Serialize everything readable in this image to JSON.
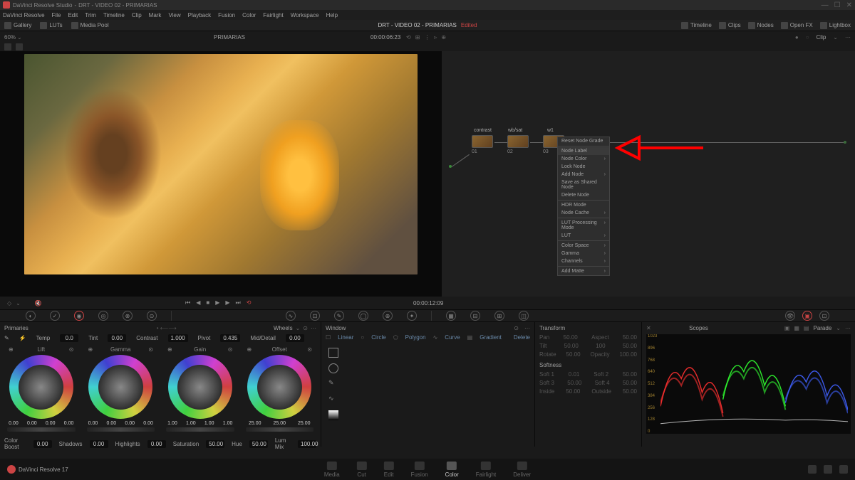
{
  "titlebar": {
    "app": "DaVinci Resolve Studio",
    "project": "DRT - VIDEO 02 - PRIMARIAS"
  },
  "menubar": [
    "DaVinci Resolve",
    "File",
    "Edit",
    "Trim",
    "Timeline",
    "Clip",
    "Mark",
    "View",
    "Playback",
    "Fusion",
    "Color",
    "Fairlight",
    "Workspace",
    "Help"
  ],
  "topbar": {
    "left": [
      "Gallery",
      "LUTs",
      "Media Pool"
    ],
    "title": "DRT - VIDEO 02 - PRIMARIAS",
    "edited": "Edited",
    "right": [
      "Timeline",
      "Clips",
      "Nodes",
      "Open FX",
      "Lightbox"
    ]
  },
  "secondbar": {
    "zoom": "60%",
    "clipname": "PRIMARIAS",
    "timecode": "00:00:06:23",
    "clip": "Clip"
  },
  "transport": {
    "timecode": "00:00:12:09"
  },
  "nodes": [
    {
      "label": "contrast",
      "num": "01"
    },
    {
      "label": "wb/sat",
      "num": "02"
    },
    {
      "label": "w1",
      "num": "03"
    }
  ],
  "context_menu": [
    {
      "label": "Reset Node Grade",
      "arrow": false
    },
    {
      "sep": true
    },
    {
      "label": "Node Label",
      "arrow": false,
      "highlighted": true
    },
    {
      "label": "Node Color",
      "arrow": true
    },
    {
      "label": "Lock Node",
      "arrow": false
    },
    {
      "label": "Add Node",
      "arrow": true
    },
    {
      "label": "Save as Shared Node",
      "arrow": false
    },
    {
      "label": "Delete Node",
      "arrow": false
    },
    {
      "sep": true
    },
    {
      "label": "HDR Mode",
      "arrow": false
    },
    {
      "label": "Node Cache",
      "arrow": true
    },
    {
      "sep": true
    },
    {
      "label": "LUT Processing Mode",
      "arrow": true
    },
    {
      "label": "LUT",
      "arrow": true
    },
    {
      "sep": true
    },
    {
      "label": "Color Space",
      "arrow": true
    },
    {
      "label": "Gamma",
      "arrow": true
    },
    {
      "label": "Channels",
      "arrow": true
    },
    {
      "sep": true
    },
    {
      "label": "Add Matte",
      "arrow": true
    }
  ],
  "primaries": {
    "title": "Primaries",
    "mode": "Wheels",
    "temp": {
      "label": "Temp",
      "val": "0.0"
    },
    "tint": {
      "label": "Tint",
      "val": "0.00"
    },
    "contrast": {
      "label": "Contrast",
      "val": "1.000"
    },
    "pivot": {
      "label": "Pivot",
      "val": "0.435"
    },
    "middetail": {
      "label": "Mid/Detail",
      "val": "0.00"
    },
    "wheels": [
      {
        "name": "Lift",
        "vals": [
          "0.00",
          "0.00",
          "0.00",
          "0.00"
        ]
      },
      {
        "name": "Gamma",
        "vals": [
          "0.00",
          "0.00",
          "0.00",
          "0.00"
        ]
      },
      {
        "name": "Gain",
        "vals": [
          "1.00",
          "1.00",
          "1.00",
          "1.00"
        ]
      },
      {
        "name": "Offset",
        "vals": [
          "25.00",
          "25.00",
          "25.00"
        ]
      }
    ],
    "bottom": {
      "colorboost": {
        "label": "Color Boost",
        "val": "0.00"
      },
      "shadows": {
        "label": "Shadows",
        "val": "0.00"
      },
      "highlights": {
        "label": "Highlights",
        "val": "0.00"
      },
      "saturation": {
        "label": "Saturation",
        "val": "50.00"
      },
      "hue": {
        "label": "Hue",
        "val": "50.00"
      },
      "lummix": {
        "label": "Lum Mix",
        "val": "100.00"
      }
    }
  },
  "qualifier": {
    "title": "Window",
    "delete": "Delete",
    "tabs": [
      "Linear",
      "Circle",
      "Polygon",
      "Curve",
      "Gradient"
    ]
  },
  "transform": {
    "title": "Transform",
    "rows": [
      {
        "l1": "Pan",
        "v1": "50.00",
        "l2": "Aspect",
        "v2": "50.00"
      },
      {
        "l1": "Tilt",
        "v1": "50.00",
        "l2": "100",
        "v2": "50.00"
      },
      {
        "l1": "Rotate",
        "v1": "50.00",
        "l2": "Opacity",
        "v2": "100.00"
      }
    ],
    "softness": "Softness",
    "soft_rows": [
      {
        "l1": "Soft 1",
        "v1": "0.01",
        "l2": "Soft 2",
        "v2": "50.00"
      },
      {
        "l1": "Soft 3",
        "v1": "50.00",
        "l2": "Soft 4",
        "v2": "50.00"
      },
      {
        "l1": "Inside",
        "v1": "50.00",
        "l2": "Outside",
        "v2": "50.00"
      }
    ]
  },
  "scopes": {
    "title": "Scopes",
    "mode": "Parade",
    "axis": [
      "1023",
      "896",
      "768",
      "640",
      "512",
      "384",
      "256",
      "128",
      "0"
    ]
  },
  "footer": {
    "version": "DaVinci Resolve 17",
    "pages": [
      "Media",
      "Cut",
      "Edit",
      "Fusion",
      "Color",
      "Fairlight",
      "Deliver"
    ],
    "active": "Color"
  }
}
